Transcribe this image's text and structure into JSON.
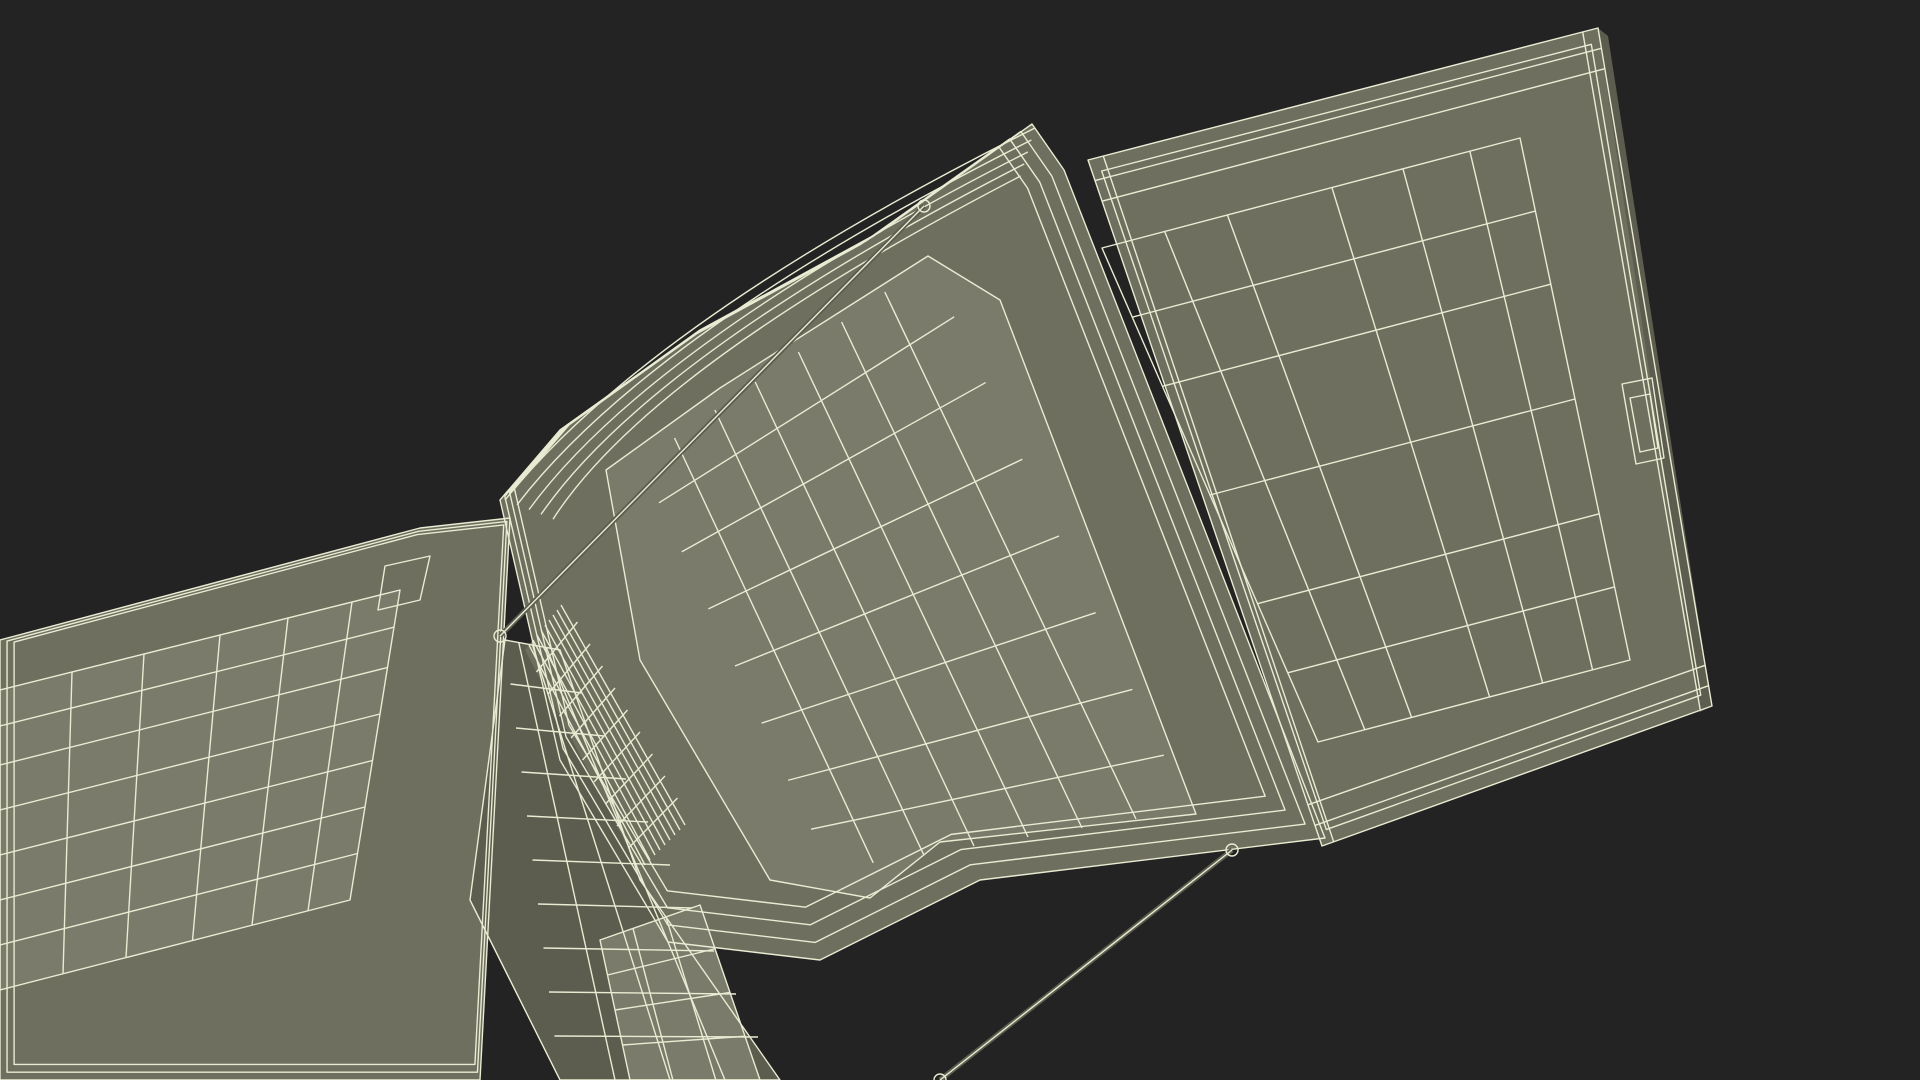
{
  "image": {
    "subject": "wireframe-render",
    "background_color": "#232323",
    "surface_color": "#6e6f5f",
    "surface_shadow_color": "#5c5d4f",
    "surface_light_color": "#7a7b6b",
    "wire_color": "#e9ebd2"
  }
}
